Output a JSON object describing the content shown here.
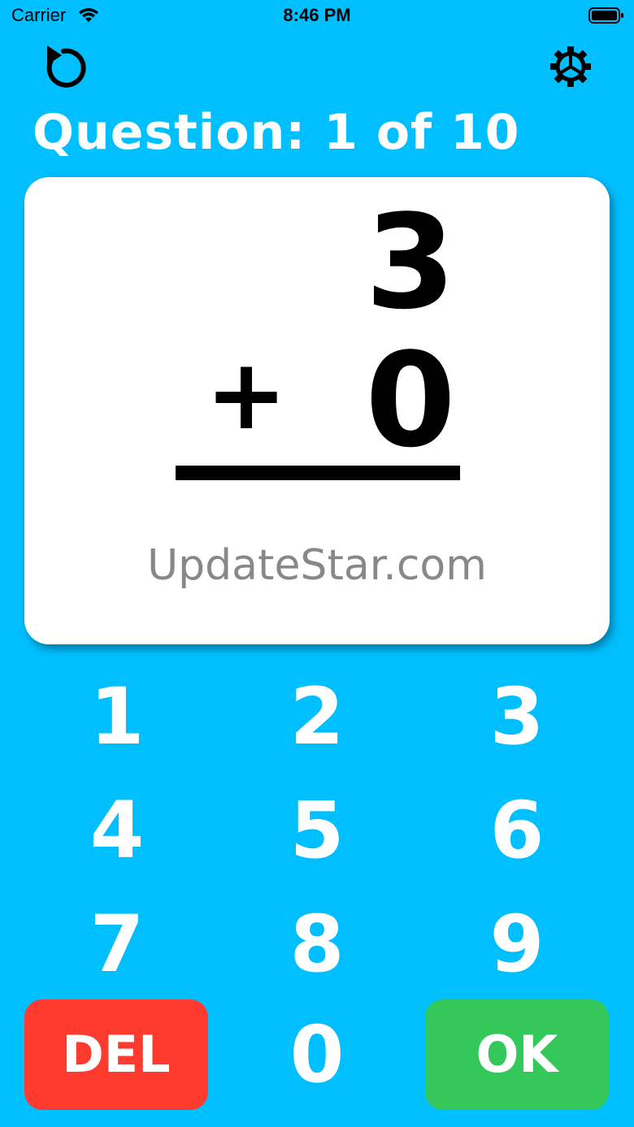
{
  "status_bar": {
    "carrier": "Carrier",
    "time": "8:46 PM"
  },
  "header": {
    "question_label": "Question: 1 of 10",
    "undo_icon": "undo-icon",
    "settings_icon": "gear-icon"
  },
  "problem": {
    "top_operand": "3",
    "operator": "+",
    "bottom_operand": "0",
    "watermark": "UpdateStar.com"
  },
  "keypad": {
    "keys": [
      "1",
      "2",
      "3",
      "4",
      "5",
      "6",
      "7",
      "8",
      "9",
      "0"
    ],
    "delete_label": "DEL",
    "ok_label": "OK"
  },
  "colors": {
    "background": "#00BFFF",
    "delete": "#FF3B30",
    "ok": "#34C759"
  }
}
